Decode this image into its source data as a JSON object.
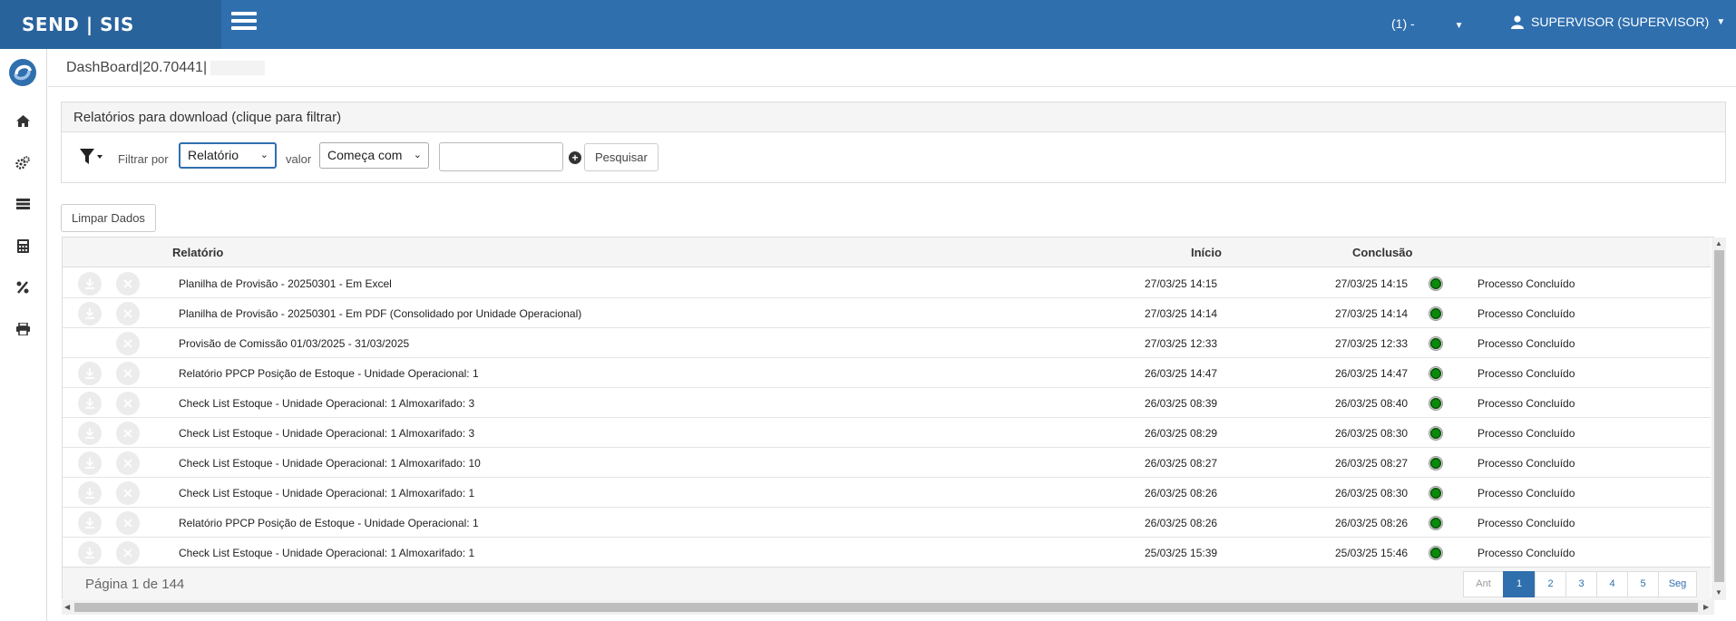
{
  "header": {
    "brand": "SEND | SIS",
    "unit_label": "(1) -",
    "user_label": "SUPERVISOR (SUPERVISOR)",
    "colors": {
      "topbar": "#2f6fae",
      "brand_bg": "#29639c"
    }
  },
  "sidebar": {
    "logo": "sendsis-logo",
    "items": [
      {
        "icon": "home-icon"
      },
      {
        "icon": "gears-icon"
      },
      {
        "icon": "list-icon"
      },
      {
        "icon": "calculator-icon"
      },
      {
        "icon": "percent-icon"
      },
      {
        "icon": "print-icon"
      }
    ]
  },
  "breadcrumb": {
    "text": "DashBoard|20.70441|"
  },
  "filter_panel": {
    "title": "Relatórios para download (clique para filtrar)",
    "filter_by_label": "Filtrar por",
    "filter_by_value": "Relatório",
    "value_label": "valor",
    "condition_value": "Começa com",
    "search_value": "",
    "search_button": "Pesquisar"
  },
  "clear_button": "Limpar Dados",
  "table": {
    "columns": {
      "report": "Relatório",
      "start": "Início",
      "end": "Conclusão"
    },
    "rows": [
      {
        "report": "Planilha de Provisão - 20250301 - Em Excel",
        "start": "27/03/25 14:15",
        "end": "27/03/25 14:15",
        "status": "Processo Concluído",
        "download": true
      },
      {
        "report": "Planilha de Provisão - 20250301 - Em PDF (Consolidado por Unidade Operacional)",
        "start": "27/03/25 14:14",
        "end": "27/03/25 14:14",
        "status": "Processo Concluído",
        "download": true
      },
      {
        "report": "Provisão de Comissão 01/03/2025 - 31/03/2025",
        "start": "27/03/25 12:33",
        "end": "27/03/25 12:33",
        "status": "Processo Concluído",
        "download": false
      },
      {
        "report": "Relatório PPCP Posição de Estoque - Unidade Operacional: 1",
        "start": "26/03/25 14:47",
        "end": "26/03/25 14:47",
        "status": "Processo Concluído",
        "download": true
      },
      {
        "report": "Check List Estoque - Unidade Operacional: 1 Almoxarifado: 3",
        "start": "26/03/25 08:39",
        "end": "26/03/25 08:40",
        "status": "Processo Concluído",
        "download": true
      },
      {
        "report": "Check List Estoque - Unidade Operacional: 1 Almoxarifado: 3",
        "start": "26/03/25 08:29",
        "end": "26/03/25 08:30",
        "status": "Processo Concluído",
        "download": true
      },
      {
        "report": "Check List Estoque - Unidade Operacional: 1 Almoxarifado: 10",
        "start": "26/03/25 08:27",
        "end": "26/03/25 08:27",
        "status": "Processo Concluído",
        "download": true
      },
      {
        "report": "Check List Estoque - Unidade Operacional: 1 Almoxarifado: 1",
        "start": "26/03/25 08:26",
        "end": "26/03/25 08:30",
        "status": "Processo Concluído",
        "download": true
      },
      {
        "report": "Relatório PPCP Posição de Estoque - Unidade Operacional: 1",
        "start": "26/03/25 08:26",
        "end": "26/03/25 08:26",
        "status": "Processo Concluído",
        "download": true
      },
      {
        "report": "Check List Estoque - Unidade Operacional: 1 Almoxarifado: 1",
        "start": "25/03/25 15:39",
        "end": "25/03/25 15:46",
        "status": "Processo Concluído",
        "download": true
      }
    ],
    "status_color": "#0a8a0a"
  },
  "pagination": {
    "info": "Página 1 de 144",
    "prev": "Ant",
    "pages": [
      "1",
      "2",
      "3",
      "4",
      "5"
    ],
    "current": "1",
    "next": "Seg"
  }
}
